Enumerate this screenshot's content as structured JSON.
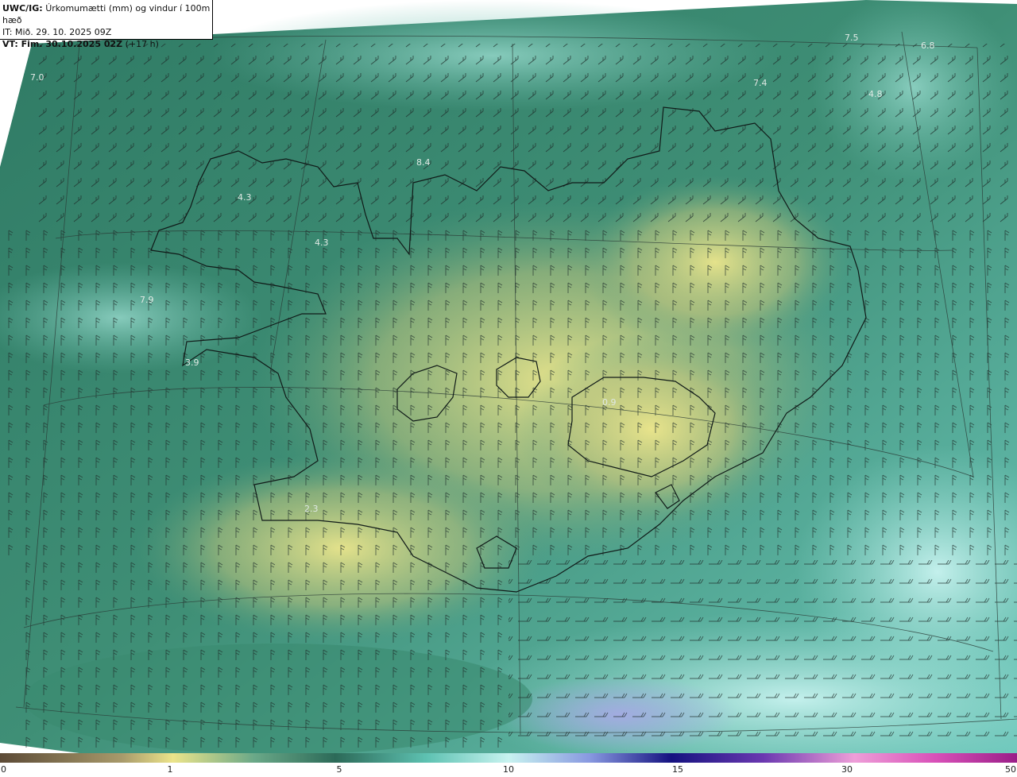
{
  "header": {
    "product": "UWC/IG:",
    "description": "Úrkomumætti (mm) og vindur í 100m hæð",
    "init_time": "IT: Mið. 29. 10. 2025 09Z",
    "valid_prefix": "VT: Fim. 30.10.2025 02Z",
    "valid_lead": "(+17 h)"
  },
  "colorbar": {
    "ticks": [
      "0",
      "1",
      "5",
      "10",
      "15",
      "30",
      "50"
    ],
    "colors": [
      "#6b5840",
      "#a79a6a",
      "#e8e08a",
      "#4f9a7e",
      "#2e6e5e",
      "#6fd0c6",
      "#b9efee",
      "#7a8ee0",
      "#1a1690",
      "#7a3ab0",
      "#e89ad8",
      "#d040b0",
      "#a01f8a"
    ]
  },
  "map_labels": [
    {
      "id": "lbl-7-0",
      "text": "7.0"
    },
    {
      "id": "lbl-7-5",
      "text": "7.5"
    },
    {
      "id": "lbl-6-8",
      "text": "6.8"
    },
    {
      "id": "lbl-7-4",
      "text": "7.4"
    },
    {
      "id": "lbl-4-8",
      "text": "4.8"
    },
    {
      "id": "lbl-8-4",
      "text": "8.4"
    },
    {
      "id": "lbl-4-3a",
      "text": "4.3"
    },
    {
      "id": "lbl-4-3b",
      "text": "4.3"
    },
    {
      "id": "lbl-7-9",
      "text": "7.9"
    },
    {
      "id": "lbl-3-9",
      "text": "3.9"
    },
    {
      "id": "lbl-0-9",
      "text": "0.9"
    },
    {
      "id": "lbl-2-3",
      "text": "2.3"
    }
  ]
}
